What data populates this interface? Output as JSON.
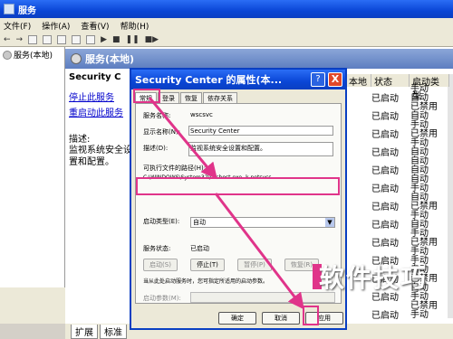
{
  "main": {
    "title": "服务",
    "menu": [
      "文件(F)",
      "操作(A)",
      "查看(V)",
      "帮助(H)"
    ],
    "tree_item": "服务(本地)",
    "header": "服务(本地)",
    "svc_title": "Security C",
    "link_stop": "停止此服务",
    "link_restart": "重启动此服务",
    "desc_label": "描述:",
    "desc_text": "监视系统安全设置和配置。",
    "columns": {
      "desc": "本地",
      "status": "状态",
      "start": "启动类型"
    },
    "status_values": [
      "已启动",
      "已启动",
      "已启动",
      "已启动",
      "已启动",
      "已启动",
      "已启动",
      "已启动",
      "已启动",
      "已启动",
      "已启动",
      "已启动",
      "已启动"
    ],
    "start_values": [
      "手动",
      "自动",
      "已禁用",
      "自动",
      "手动",
      "已禁用",
      "手动",
      "自动",
      "自动",
      "自动",
      "自动",
      "手动",
      "自动",
      "已禁用",
      "手动",
      "自动",
      "手动",
      "已禁用",
      "手动",
      "手动",
      "自动",
      "已禁用",
      "自动",
      "手动",
      "已禁用",
      "手动"
    ],
    "tabs": [
      "扩展",
      "标准"
    ]
  },
  "dialog": {
    "title": "Security Center 的属性(本...",
    "help": "?",
    "close": "X",
    "tabs": [
      "常规",
      "登录",
      "恢复",
      "依存关系"
    ],
    "service_name_label": "服务名称:",
    "service_name_value": "wscsvc",
    "display_name_label": "显示名称(N):",
    "display_name_value": "Security Center",
    "description_label": "描述(D):",
    "description_value": "监视系统安全设置和配置。",
    "path_label": "可执行文件的路径(H):",
    "path_value": "C:\\WINDOWS\\System32\\svchost.exe -k netsvcs",
    "startup_label": "启动类型(E):",
    "startup_value": "自动",
    "status_label": "服务状态:",
    "status_value": "已启动",
    "buttons": {
      "start": "启动(S)",
      "stop": "停止(T)",
      "pause": "暂停(P)",
      "resume": "恢复(R)"
    },
    "hint": "当从此处启动服务时，您可指定所适用的启动参数。",
    "param_label": "启动参数(M):",
    "ok": "确定",
    "cancel": "取消",
    "apply": "应用"
  },
  "watermark": "软件技巧",
  "colors": {
    "highlight": "#e0348a",
    "titlebar": "#0a46d6"
  }
}
